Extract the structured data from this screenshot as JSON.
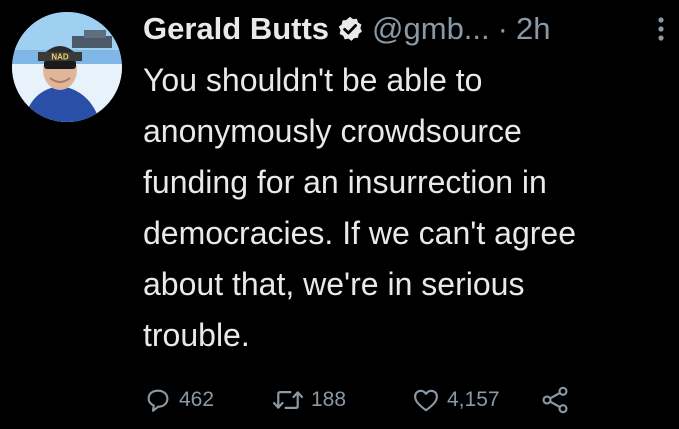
{
  "tweet": {
    "author_name": "Gerald Butts",
    "handle": "@gmb...",
    "separator": "·",
    "time": "2h",
    "text": "You shouldn't be able to\nanonymously crowdsource\nfunding for an insurrection in\ndemocracies. If we can't agree\nabout that, we're in serious\ntrouble.",
    "avatar_text": "NAD",
    "verified": true
  },
  "actions": {
    "replies": "462",
    "retweets": "188",
    "likes": "4,157"
  },
  "icons": {
    "verified": "verified-badge-icon",
    "more": "more-icon",
    "reply": "reply-icon",
    "retweet": "retweet-icon",
    "like": "heart-icon",
    "share": "share-icon"
  },
  "colors": {
    "background": "#000000",
    "primary_text": "#e7e9ea",
    "secondary_text": "#8b98a5"
  }
}
